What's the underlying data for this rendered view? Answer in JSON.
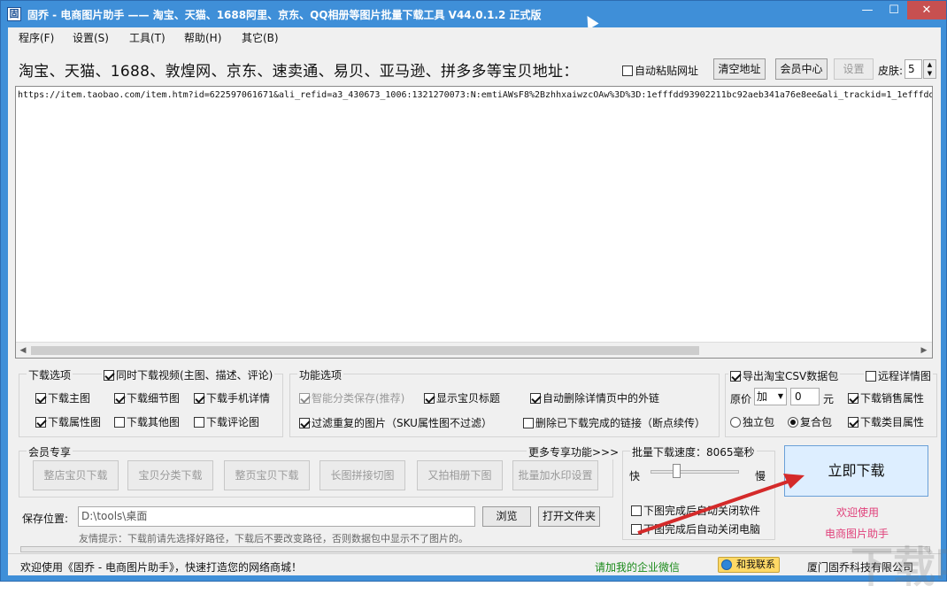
{
  "window": {
    "title": "固乔 - 电商图片助手 —— 淘宝、天猫、1688阿里、京东、QQ相册等图片批量下载工具 V44.0.1.2 正式版",
    "app_icon": "app-icon",
    "min_glyph": "—",
    "max_glyph": "☐",
    "close_glyph": "✕"
  },
  "menu": [
    "程序(F)",
    "设置(S)",
    "工具(T)",
    "帮助(H)",
    "其它(B)"
  ],
  "toolbar": {
    "url_label": "淘宝、天猫、1688、敦煌网、京东、速卖通、易贝、亚马逊、拼多多等宝贝地址：",
    "auto_paste": "自动粘贴网址",
    "clear": "清空地址",
    "vip_center": "会员中心",
    "settings": "设置",
    "skin_label": "皮肤:",
    "skin_value": "5"
  },
  "url_text": "https://item.taobao.com/item.htm?id=622597061671&ali_refid=a3_430673_1006:1321270073:N:emtiAWsF8%2BzhhxaiwzcOAw%3D%3D:1efffdd93902211bc92aeb341a76e8ee&ali_trackid=1_1efffdd",
  "download_options": {
    "title": "下载选项",
    "video": "同时下载视频(主图、描述、评论)",
    "main_img": "下载主图",
    "detail_img": "下载细节图",
    "mobile_detail": "下载手机详情",
    "attr_img": "下载属性图",
    "other_img": "下载其他图",
    "review_img": "下载评论图"
  },
  "function_options": {
    "title": "功能选项",
    "smart_category": "智能分类保存(推荐)",
    "show_title": "显示宝贝标题",
    "remove_links": "自动删除详情页中的外链",
    "filter_dup": "过滤重复的图片（SKU属性图不过滤）",
    "delete_done": "删除已下载完成的链接（断点续传）"
  },
  "right_options": {
    "export_csv": "导出淘宝CSV数据包",
    "remote_detail": "远程详情图",
    "price_label": "原价",
    "price_op": "加",
    "price_value": "0",
    "price_unit": "元",
    "sales_attr": "下载销售属性",
    "single_pack": "独立包",
    "combined_pack": "复合包",
    "category_attr": "下载类目属性"
  },
  "vip": {
    "title": "会员专享",
    "more": "更多专享功能>>>",
    "buttons": [
      "整店宝贝下载",
      "宝贝分类下载",
      "整页宝贝下载",
      "长图拼接切图",
      "又拍相册下图",
      "批量加水印设置"
    ]
  },
  "speed": {
    "title": "批量下载速度：8065毫秒",
    "fast": "快",
    "slow": "慢",
    "close_app": "下图完成后自动关闭软件",
    "shutdown": "下图完成后自动关闭电脑"
  },
  "start_button": "立即下载",
  "welcome1": "欢迎使用",
  "welcome2": "电商图片助手",
  "save": {
    "label": "保存位置:",
    "path": "D:\\tools\\桌面",
    "browse": "浏览",
    "open_folder": "打开文件夹",
    "hint": "友情提示：下载前请先选择好路径，下载后不要改变路径，否则数据包中显示不了图片的。"
  },
  "status": {
    "left": "欢迎使用《固乔 - 电商图片助手》，快速打造您的网络商城！",
    "wechat": "请加我的企业微信",
    "contact": "和我联系",
    "company": "厦门固乔科技有限公司"
  },
  "colors": {
    "titlebar": "#3f8fd8",
    "close": "#c75050",
    "link_green": "#1a8a1a",
    "pink": "#e0407a",
    "arrow": "#d42a2a"
  }
}
